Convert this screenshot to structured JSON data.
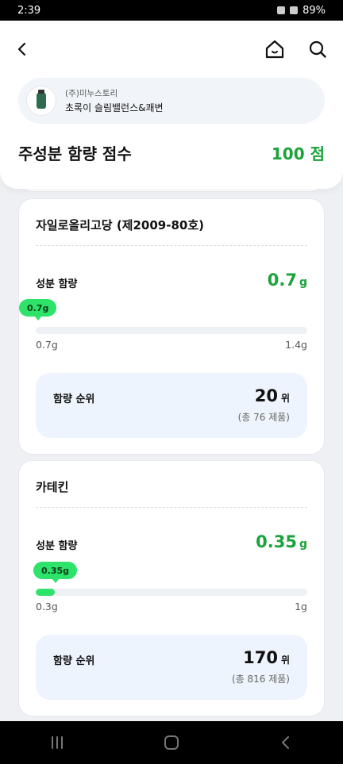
{
  "status": {
    "time": "2:39",
    "battery": "89%"
  },
  "header": {
    "company": "(주)미누스토리",
    "product": "초록이 슬림밸런스&쾌변",
    "score_title": "주성분 함량 점수",
    "score_value": "100 점"
  },
  "ingredients": [
    {
      "name": "자일로올리고당 (제2009-80호)",
      "amount_label": "성분 함량",
      "amount_value": "0.7",
      "amount_unit": "g",
      "bubble": "0.7g",
      "range_min": "0.7g",
      "range_max": "1.4g",
      "level": 0.0,
      "rank_label": "함량 순위",
      "rank_value": "20",
      "rank_unit": "위",
      "rank_total": "(총 76 제품)"
    },
    {
      "name": "카테킨",
      "amount_label": "성분 함량",
      "amount_value": "0.35",
      "amount_unit": "g",
      "bubble": "0.35g",
      "range_min": "0.3g",
      "range_max": "1g",
      "level": 0.07,
      "rank_label": "함량 순위",
      "rank_value": "170",
      "rank_unit": "위",
      "rank_total": "(총 816 제품)"
    }
  ],
  "colors": {
    "accent": "#19a33a",
    "bubble": "#2ee36a",
    "rank_bg": "#eef4fd"
  },
  "icons": [
    "back-arrow-icon",
    "home-icon",
    "search-icon",
    "recents-icon",
    "home-circle-icon",
    "nav-back-icon"
  ]
}
